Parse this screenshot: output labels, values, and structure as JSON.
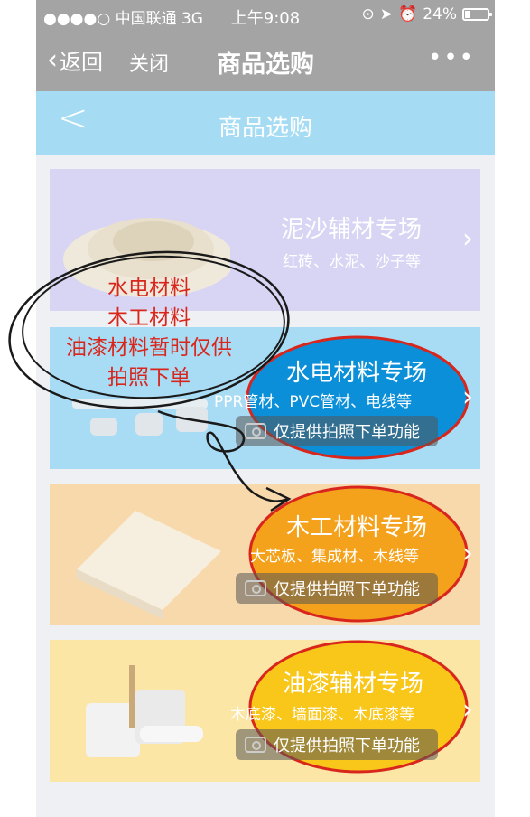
{
  "status_bar": {
    "carrier": "●●●●○ 中国联通  3G",
    "time": "上午9:08",
    "battery": "24%",
    "icons": [
      "lock-rotation-icon",
      "location-icon",
      "alarm-icon",
      "battery-icon"
    ]
  },
  "nav": {
    "back_label": "返回",
    "close_label": "关闭",
    "title": "商品选购",
    "more_icon": "more-icon"
  },
  "sub_header": {
    "title": "商品选购"
  },
  "cards": [
    {
      "name": "泥沙辅材专场",
      "desc": "红砖、水泥、沙子等",
      "color": "#d8d4f4"
    },
    {
      "name": "水电材料专场",
      "desc": "PPR管材、PVC管材、电线等",
      "photo_tag": "仅提供拍照下单功能",
      "color": "#a8dbf4"
    },
    {
      "name": "木工材料专场",
      "desc": "大芯板、集成材、木线等",
      "photo_tag": "仅提供拍照下单功能",
      "color": "#f8d9ab"
    },
    {
      "name": "油漆辅材专场",
      "desc": "木底漆、墙面漆、木底漆等",
      "photo_tag": "仅提供拍照下单功能",
      "color": "#fbe6a6"
    }
  ],
  "annotation": {
    "lines": [
      "水电材料",
      "木工材料",
      "油漆材料暂时仅供",
      "拍照下单"
    ],
    "color": "#d9261c"
  },
  "highlight_colors": {
    "blue": "#0a8fd8",
    "orange": "#f4a21c",
    "yellow": "#f9c61a",
    "outline": "#d9261c"
  }
}
